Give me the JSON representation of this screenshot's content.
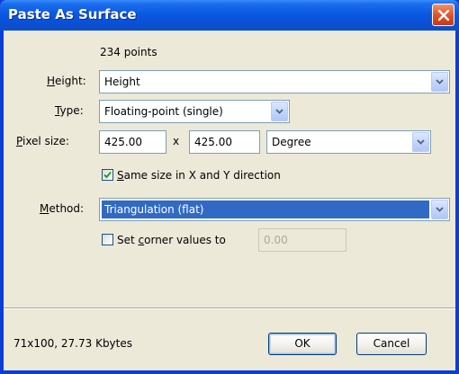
{
  "window": {
    "title": "Paste As Surface"
  },
  "info": {
    "points": "234 points"
  },
  "height": {
    "label_u": "H",
    "label_rest": "eight:",
    "value": "Height"
  },
  "type": {
    "label_u": "T",
    "label_rest": "ype:",
    "value": "Floating-point (single)"
  },
  "pixel_size": {
    "label_u": "P",
    "label_rest": "ixel size:",
    "x_value": "425.00",
    "times": "x",
    "y_value": "425.00",
    "unit": "Degree"
  },
  "same_size": {
    "checked": true,
    "label_u": "S",
    "label_rest": "ame size in X and Y direction"
  },
  "method": {
    "label_u": "M",
    "label_rest": "ethod:",
    "value": "Triangulation (flat)"
  },
  "corner": {
    "checked": false,
    "label_pre": "Set ",
    "label_u": "c",
    "label_rest": "orner values to",
    "value": "0.00"
  },
  "footer": {
    "status": "71x100, 27.73 Kbytes",
    "ok_label": "OK",
    "cancel_label": "Cancel"
  },
  "colors": {
    "title_bar": "#0a50d6",
    "client_bg": "#ece9d8",
    "selection": "#316ac5"
  }
}
